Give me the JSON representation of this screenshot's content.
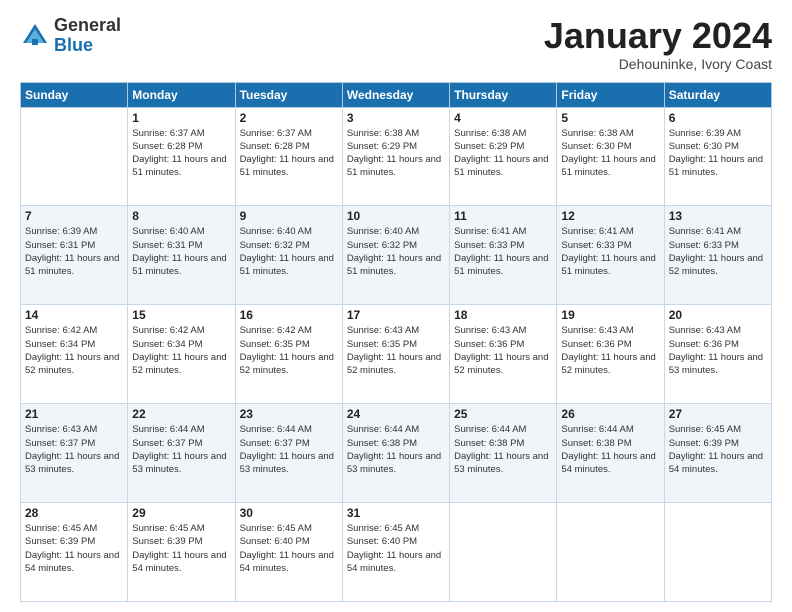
{
  "header": {
    "logo_general": "General",
    "logo_blue": "Blue",
    "title": "January 2024",
    "location": "Dehouninke, Ivory Coast"
  },
  "days_of_week": [
    "Sunday",
    "Monday",
    "Tuesday",
    "Wednesday",
    "Thursday",
    "Friday",
    "Saturday"
  ],
  "weeks": [
    [
      {
        "day": "",
        "sunrise": "",
        "sunset": "",
        "daylight": ""
      },
      {
        "day": "1",
        "sunrise": "Sunrise: 6:37 AM",
        "sunset": "Sunset: 6:28 PM",
        "daylight": "Daylight: 11 hours and 51 minutes."
      },
      {
        "day": "2",
        "sunrise": "Sunrise: 6:37 AM",
        "sunset": "Sunset: 6:28 PM",
        "daylight": "Daylight: 11 hours and 51 minutes."
      },
      {
        "day": "3",
        "sunrise": "Sunrise: 6:38 AM",
        "sunset": "Sunset: 6:29 PM",
        "daylight": "Daylight: 11 hours and 51 minutes."
      },
      {
        "day": "4",
        "sunrise": "Sunrise: 6:38 AM",
        "sunset": "Sunset: 6:29 PM",
        "daylight": "Daylight: 11 hours and 51 minutes."
      },
      {
        "day": "5",
        "sunrise": "Sunrise: 6:38 AM",
        "sunset": "Sunset: 6:30 PM",
        "daylight": "Daylight: 11 hours and 51 minutes."
      },
      {
        "day": "6",
        "sunrise": "Sunrise: 6:39 AM",
        "sunset": "Sunset: 6:30 PM",
        "daylight": "Daylight: 11 hours and 51 minutes."
      }
    ],
    [
      {
        "day": "7",
        "sunrise": "Sunrise: 6:39 AM",
        "sunset": "Sunset: 6:31 PM",
        "daylight": "Daylight: 11 hours and 51 minutes."
      },
      {
        "day": "8",
        "sunrise": "Sunrise: 6:40 AM",
        "sunset": "Sunset: 6:31 PM",
        "daylight": "Daylight: 11 hours and 51 minutes."
      },
      {
        "day": "9",
        "sunrise": "Sunrise: 6:40 AM",
        "sunset": "Sunset: 6:32 PM",
        "daylight": "Daylight: 11 hours and 51 minutes."
      },
      {
        "day": "10",
        "sunrise": "Sunrise: 6:40 AM",
        "sunset": "Sunset: 6:32 PM",
        "daylight": "Daylight: 11 hours and 51 minutes."
      },
      {
        "day": "11",
        "sunrise": "Sunrise: 6:41 AM",
        "sunset": "Sunset: 6:33 PM",
        "daylight": "Daylight: 11 hours and 51 minutes."
      },
      {
        "day": "12",
        "sunrise": "Sunrise: 6:41 AM",
        "sunset": "Sunset: 6:33 PM",
        "daylight": "Daylight: 11 hours and 51 minutes."
      },
      {
        "day": "13",
        "sunrise": "Sunrise: 6:41 AM",
        "sunset": "Sunset: 6:33 PM",
        "daylight": "Daylight: 11 hours and 52 minutes."
      }
    ],
    [
      {
        "day": "14",
        "sunrise": "Sunrise: 6:42 AM",
        "sunset": "Sunset: 6:34 PM",
        "daylight": "Daylight: 11 hours and 52 minutes."
      },
      {
        "day": "15",
        "sunrise": "Sunrise: 6:42 AM",
        "sunset": "Sunset: 6:34 PM",
        "daylight": "Daylight: 11 hours and 52 minutes."
      },
      {
        "day": "16",
        "sunrise": "Sunrise: 6:42 AM",
        "sunset": "Sunset: 6:35 PM",
        "daylight": "Daylight: 11 hours and 52 minutes."
      },
      {
        "day": "17",
        "sunrise": "Sunrise: 6:43 AM",
        "sunset": "Sunset: 6:35 PM",
        "daylight": "Daylight: 11 hours and 52 minutes."
      },
      {
        "day": "18",
        "sunrise": "Sunrise: 6:43 AM",
        "sunset": "Sunset: 6:36 PM",
        "daylight": "Daylight: 11 hours and 52 minutes."
      },
      {
        "day": "19",
        "sunrise": "Sunrise: 6:43 AM",
        "sunset": "Sunset: 6:36 PM",
        "daylight": "Daylight: 11 hours and 52 minutes."
      },
      {
        "day": "20",
        "sunrise": "Sunrise: 6:43 AM",
        "sunset": "Sunset: 6:36 PM",
        "daylight": "Daylight: 11 hours and 53 minutes."
      }
    ],
    [
      {
        "day": "21",
        "sunrise": "Sunrise: 6:43 AM",
        "sunset": "Sunset: 6:37 PM",
        "daylight": "Daylight: 11 hours and 53 minutes."
      },
      {
        "day": "22",
        "sunrise": "Sunrise: 6:44 AM",
        "sunset": "Sunset: 6:37 PM",
        "daylight": "Daylight: 11 hours and 53 minutes."
      },
      {
        "day": "23",
        "sunrise": "Sunrise: 6:44 AM",
        "sunset": "Sunset: 6:37 PM",
        "daylight": "Daylight: 11 hours and 53 minutes."
      },
      {
        "day": "24",
        "sunrise": "Sunrise: 6:44 AM",
        "sunset": "Sunset: 6:38 PM",
        "daylight": "Daylight: 11 hours and 53 minutes."
      },
      {
        "day": "25",
        "sunrise": "Sunrise: 6:44 AM",
        "sunset": "Sunset: 6:38 PM",
        "daylight": "Daylight: 11 hours and 53 minutes."
      },
      {
        "day": "26",
        "sunrise": "Sunrise: 6:44 AM",
        "sunset": "Sunset: 6:38 PM",
        "daylight": "Daylight: 11 hours and 54 minutes."
      },
      {
        "day": "27",
        "sunrise": "Sunrise: 6:45 AM",
        "sunset": "Sunset: 6:39 PM",
        "daylight": "Daylight: 11 hours and 54 minutes."
      }
    ],
    [
      {
        "day": "28",
        "sunrise": "Sunrise: 6:45 AM",
        "sunset": "Sunset: 6:39 PM",
        "daylight": "Daylight: 11 hours and 54 minutes."
      },
      {
        "day": "29",
        "sunrise": "Sunrise: 6:45 AM",
        "sunset": "Sunset: 6:39 PM",
        "daylight": "Daylight: 11 hours and 54 minutes."
      },
      {
        "day": "30",
        "sunrise": "Sunrise: 6:45 AM",
        "sunset": "Sunset: 6:40 PM",
        "daylight": "Daylight: 11 hours and 54 minutes."
      },
      {
        "day": "31",
        "sunrise": "Sunrise: 6:45 AM",
        "sunset": "Sunset: 6:40 PM",
        "daylight": "Daylight: 11 hours and 54 minutes."
      },
      {
        "day": "",
        "sunrise": "",
        "sunset": "",
        "daylight": ""
      },
      {
        "day": "",
        "sunrise": "",
        "sunset": "",
        "daylight": ""
      },
      {
        "day": "",
        "sunrise": "",
        "sunset": "",
        "daylight": ""
      }
    ]
  ]
}
